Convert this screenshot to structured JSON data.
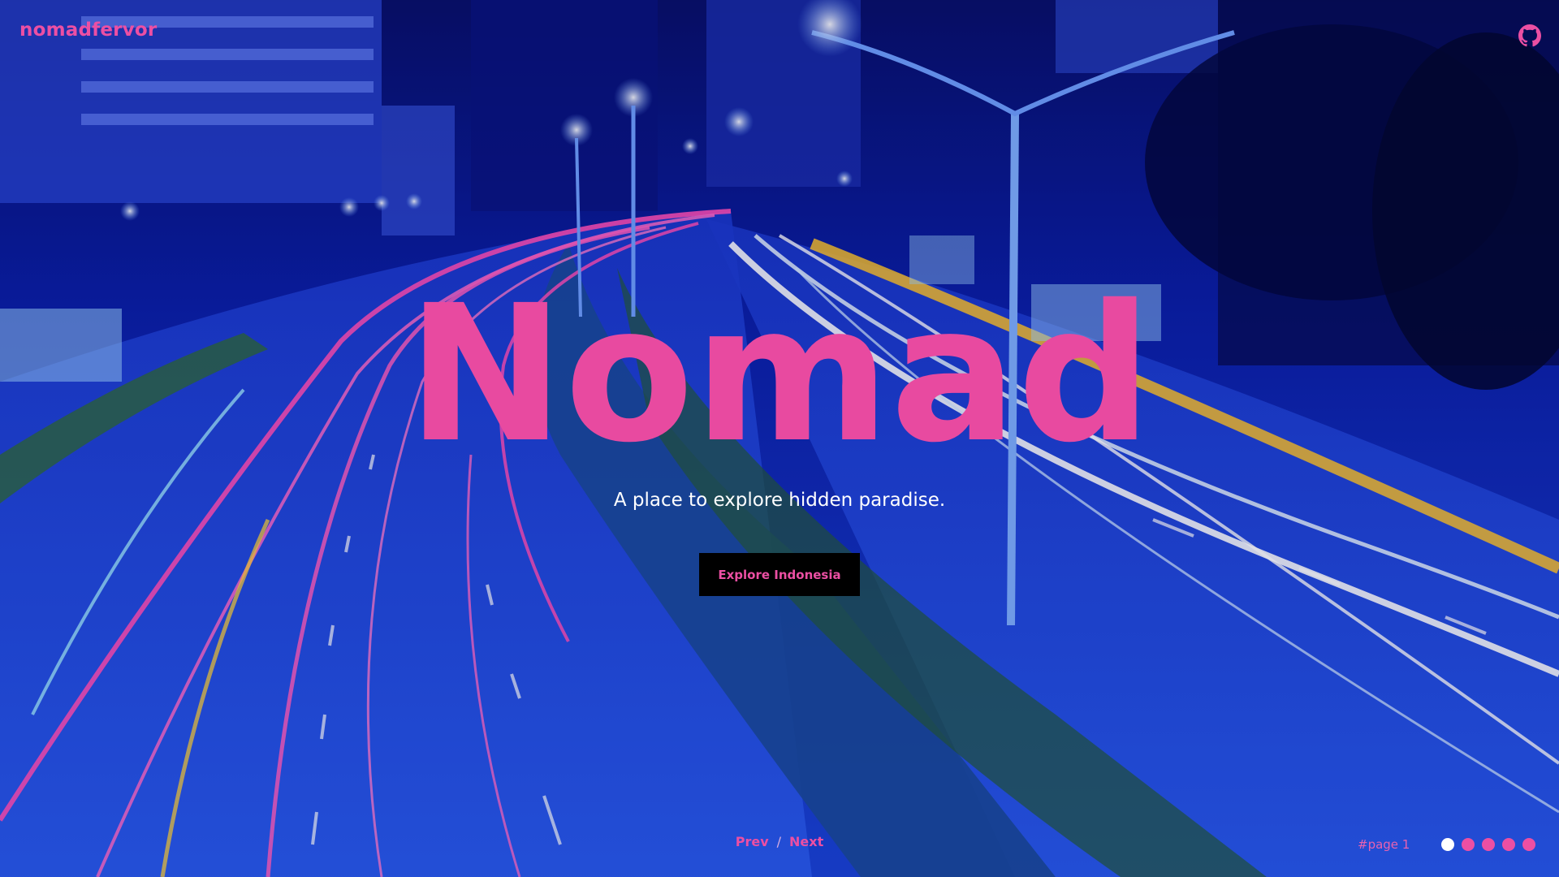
{
  "brand": {
    "name": "nomadfervor"
  },
  "header": {
    "github_icon": "github-icon"
  },
  "hero": {
    "title": "Nomad",
    "subtitle": "A place to explore hidden paradise.",
    "cta_label": "Explore Indonesia"
  },
  "pager": {
    "prev_label": "Prev",
    "separator": "/",
    "next_label": "Next",
    "page_label": "#page 1",
    "dot_count": 5,
    "active_dot": 1
  },
  "colors": {
    "accent": "#ec4fa3",
    "button_bg": "#000000",
    "text_light": "#ffffff"
  }
}
